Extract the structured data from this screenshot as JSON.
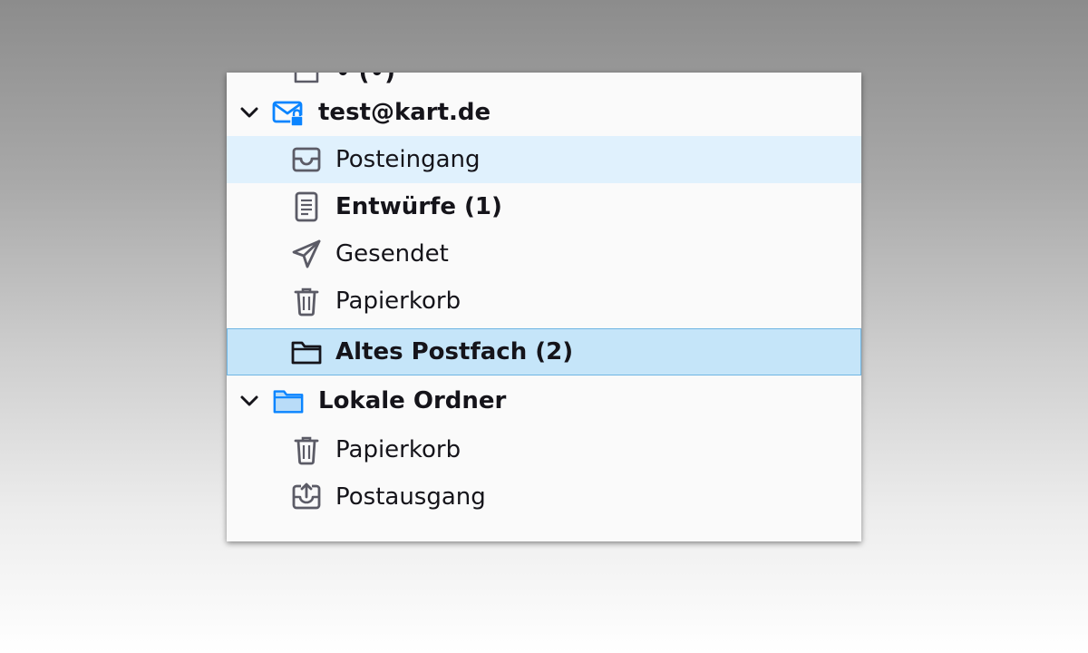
{
  "folder_pane": {
    "top_partial": {
      "label": "• (•)",
      "icon": "folder-icon"
    },
    "accounts": [
      {
        "name": "test@kart.de",
        "icon": "mail-lock-icon",
        "expanded": true,
        "folders": [
          {
            "label": "Posteingang",
            "icon": "inbox-icon",
            "state": "hover"
          },
          {
            "label": "Entwürfe (1)",
            "icon": "drafts-icon",
            "bold": true
          },
          {
            "label": "Gesendet",
            "icon": "sent-icon"
          },
          {
            "label": "Papierkorb",
            "icon": "trash-icon"
          },
          {
            "label": "Altes Postfach (2)",
            "icon": "folder-icon",
            "bold": true,
            "state": "selected"
          }
        ]
      },
      {
        "name": "Lokale Ordner",
        "icon": "local-folder-icon",
        "expanded": true,
        "folders": [
          {
            "label": "Papierkorb",
            "icon": "trash-icon"
          },
          {
            "label": "Postausgang",
            "icon": "outbox-icon"
          }
        ]
      }
    ]
  },
  "colors": {
    "hover_bg": "#e0f1fd",
    "selected_bg": "#c5e5f9",
    "selected_border": "#6fb5e3",
    "icon_stroke": "#5b5b66",
    "account_blue": "#0a84ff"
  }
}
